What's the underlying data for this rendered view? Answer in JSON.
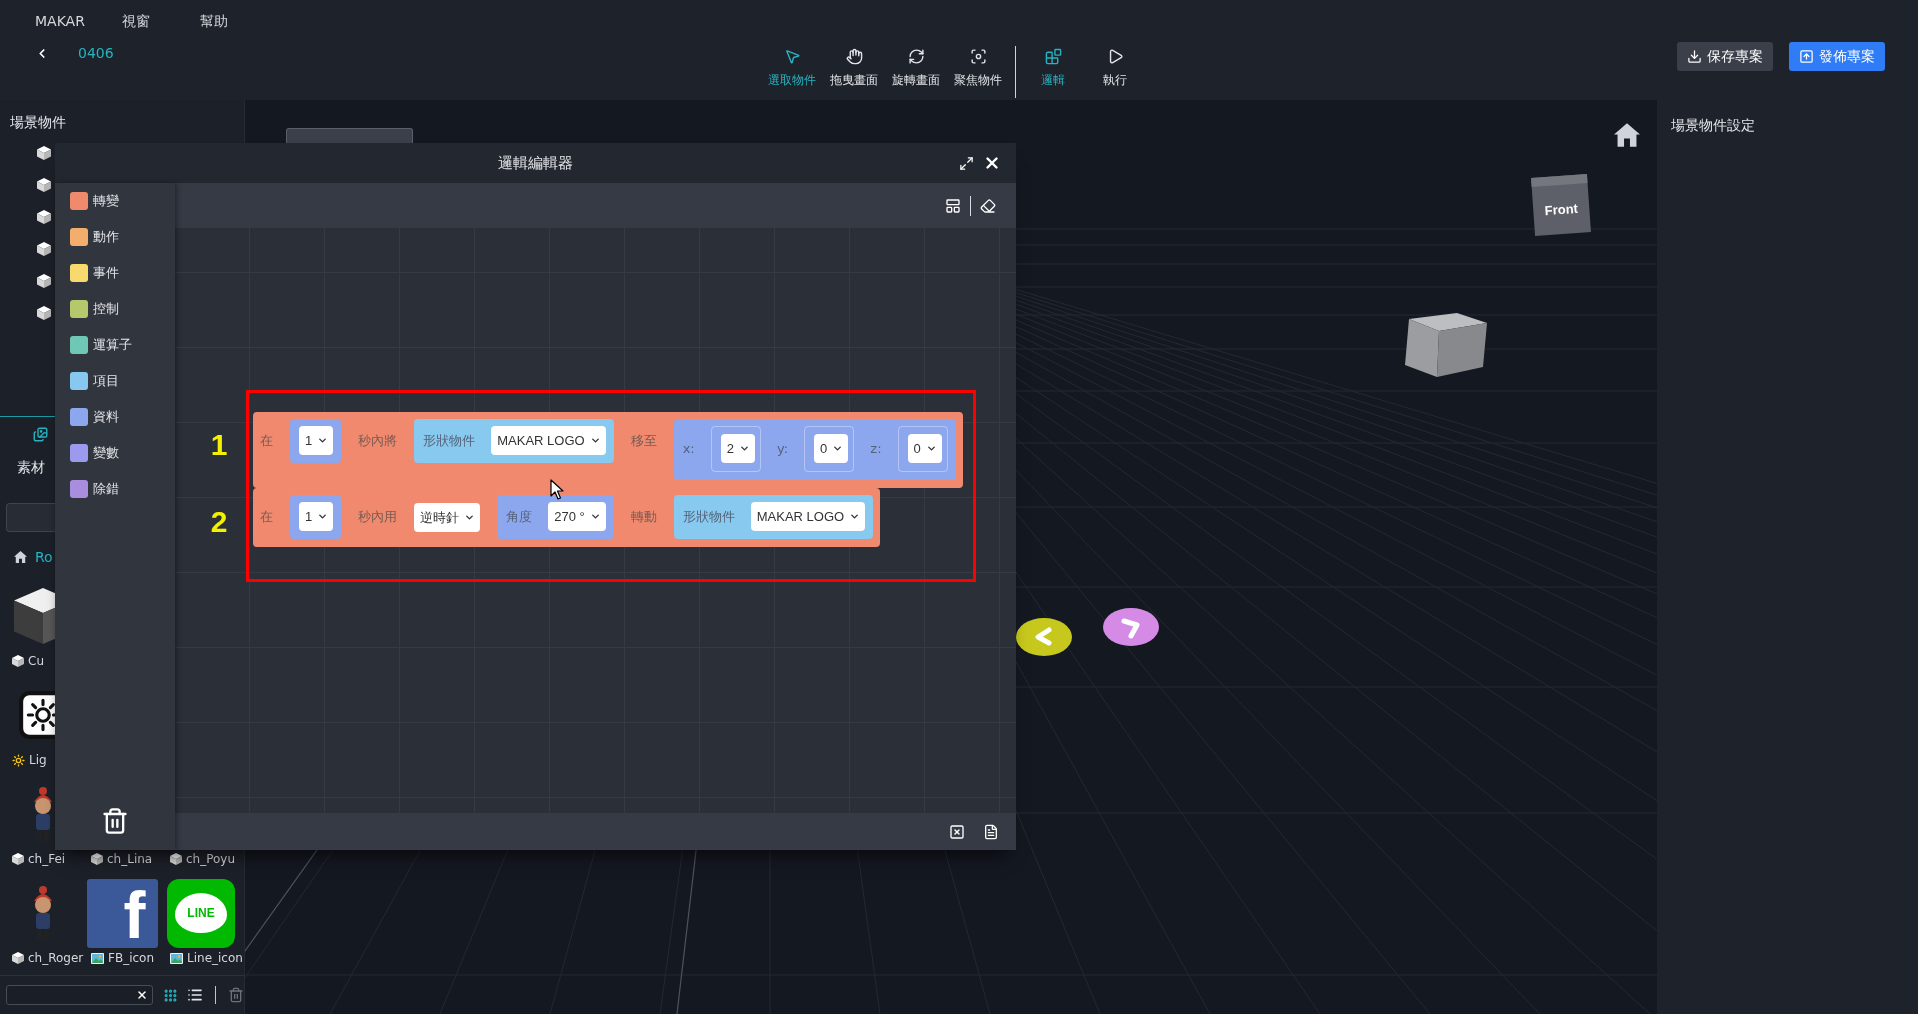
{
  "menu_bar": {
    "items": [
      {
        "label": "MAKAR"
      },
      {
        "label": "視窗"
      },
      {
        "label": "幫助"
      }
    ]
  },
  "project": {
    "name": "0406"
  },
  "toolbar": {
    "tools": [
      {
        "label": "選取物件",
        "kind": "pointer",
        "selected": true
      },
      {
        "label": "拖曳畫面",
        "kind": "hand",
        "selected": false
      },
      {
        "label": "旋轉畫面",
        "kind": "rotate",
        "selected": false
      },
      {
        "label": "聚焦物件",
        "kind": "focus",
        "selected": false
      }
    ],
    "modes": [
      {
        "label": "邏輯",
        "kind": "logic",
        "selected": true
      },
      {
        "label": "執行",
        "kind": "play",
        "selected": false
      }
    ]
  },
  "actions": [
    {
      "label": "保存專案",
      "kind": "save"
    },
    {
      "label": "發佈專案",
      "kind": "publish"
    }
  ],
  "scene_panel": {
    "title": "場景物件",
    "items": [
      {
        "kind": "cube"
      },
      {
        "kind": "cube"
      },
      {
        "kind": "cube"
      },
      {
        "kind": "cube"
      },
      {
        "kind": "cube"
      },
      {
        "kind": "cube"
      }
    ]
  },
  "asset_panel": {
    "tab": {
      "label": "素材",
      "selected": true
    },
    "breadcrumb": "Ro",
    "rows": [
      {
        "items": [
          {
            "label": "Cu",
            "kind": "model",
            "thumb": {
              "kind": "cube"
            }
          }
        ]
      },
      {
        "items": [
          {
            "label": "Lig",
            "kind": "light",
            "thumb": {
              "kind": "light"
            }
          }
        ]
      },
      {
        "items": [
          {
            "label": "ch_Fei",
            "kind": "model",
            "thumb": {
              "kind": "character"
            }
          },
          {
            "label": "ch_Lina",
            "kind": "model"
          },
          {
            "label": "ch_Poyu",
            "kind": "model"
          }
        ]
      },
      {
        "items": [
          {
            "label": "ch_Roger",
            "kind": "model",
            "thumb": {
              "kind": "character"
            }
          },
          {
            "label": "FB_icon",
            "kind": "image",
            "thumb": {
              "kind": "facebook",
              "logo": "f"
            }
          },
          {
            "label": "Line_icon",
            "kind": "image",
            "thumb": {
              "kind": "line",
              "logo": "LINE"
            }
          }
        ]
      }
    ],
    "view_modes": [
      {
        "kind": "grid",
        "selected": true
      },
      {
        "kind": "list",
        "selected": false
      }
    ]
  },
  "viewport": {
    "view_cube": {
      "face": "Front"
    }
  },
  "settings_panel": {
    "title": "場景物件設定"
  },
  "logic_editor": {
    "title": "邏輯編輯器",
    "categories": [
      {
        "label": "轉變",
        "color": "#ef8a6d"
      },
      {
        "label": "動作",
        "color": "#f3ad6c"
      },
      {
        "label": "事件",
        "color": "#f7d96d"
      },
      {
        "label": "控制",
        "color": "#b5c86c"
      },
      {
        "label": "運算子",
        "color": "#6fc8b6"
      },
      {
        "label": "項目",
        "color": "#86c8ef"
      },
      {
        "label": "資料",
        "color": "#8da7ef"
      },
      {
        "label": "變數",
        "color": "#9b9aef"
      },
      {
        "label": "除錯",
        "color": "#a98ddf"
      }
    ],
    "annotations": [
      {
        "label": "1"
      },
      {
        "label": "2"
      }
    ],
    "blocks": [
      {
        "parts": [
          {
            "kind": "text",
            "text": "在"
          },
          {
            "kind": "slot",
            "color": "#8da7ef",
            "parts": [
              {
                "kind": "dropdown",
                "value": "1"
              }
            ]
          },
          {
            "kind": "text",
            "text": "秒內將"
          },
          {
            "kind": "slot",
            "color": "#87c9ef",
            "parts": [
              {
                "kind": "text",
                "text": "形狀物件"
              },
              {
                "kind": "dropdown",
                "value": "MAKAR LOGO"
              }
            ]
          },
          {
            "kind": "text",
            "text": "移至"
          },
          {
            "kind": "slot",
            "color": "#8da7ef",
            "parts": [
              {
                "kind": "text",
                "text": "x:"
              },
              {
                "kind": "socket",
                "parts": [
                  {
                    "kind": "dropdown",
                    "value": "2"
                  }
                ]
              },
              {
                "kind": "text",
                "text": "y:"
              },
              {
                "kind": "socket",
                "parts": [
                  {
                    "kind": "dropdown",
                    "value": "0"
                  }
                ]
              },
              {
                "kind": "text",
                "text": "z:"
              },
              {
                "kind": "socket",
                "parts": [
                  {
                    "kind": "dropdown",
                    "value": "0"
                  }
                ]
              }
            ]
          }
        ]
      },
      {
        "parts": [
          {
            "kind": "text",
            "text": "在"
          },
          {
            "kind": "slot",
            "color": "#8da7ef",
            "parts": [
              {
                "kind": "dropdown",
                "value": "1"
              }
            ]
          },
          {
            "kind": "text",
            "text": "秒內用"
          },
          {
            "kind": "dropdown",
            "value": "逆時針"
          },
          {
            "kind": "slot",
            "color": "#8da7ef",
            "parts": [
              {
                "kind": "text",
                "text": "角度"
              },
              {
                "kind": "dropdown",
                "value": "270 °"
              }
            ]
          },
          {
            "kind": "text",
            "text": "轉動"
          },
          {
            "kind": "slot",
            "color": "#87c9ef",
            "parts": [
              {
                "kind": "text",
                "text": "形狀物件"
              },
              {
                "kind": "dropdown",
                "value": "MAKAR LOGO"
              }
            ]
          }
        ]
      }
    ]
  }
}
